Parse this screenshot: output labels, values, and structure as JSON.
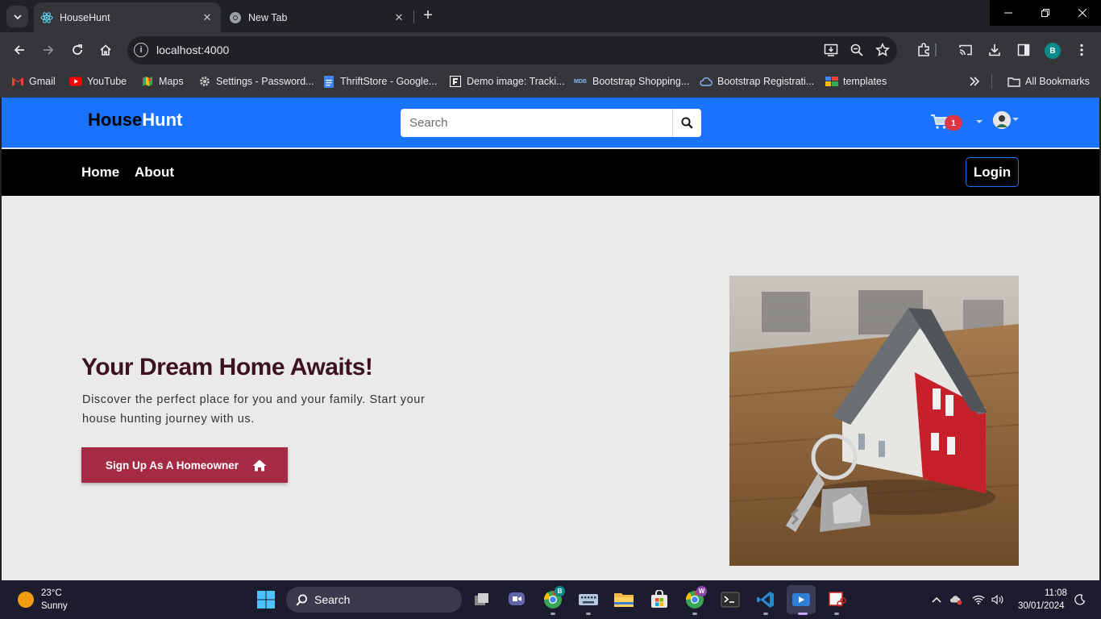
{
  "browser": {
    "tabs": [
      {
        "title": "HouseHunt",
        "active": true,
        "icon": "react-icon"
      },
      {
        "title": "New Tab",
        "active": false,
        "icon": "chrome-icon"
      }
    ],
    "url": "localhost:4000",
    "profile_initial": "B",
    "bookmarks": [
      {
        "label": "Gmail",
        "icon": "gmail-icon"
      },
      {
        "label": "YouTube",
        "icon": "youtube-icon"
      },
      {
        "label": "Maps",
        "icon": "maps-icon"
      },
      {
        "label": "Settings - Password...",
        "icon": "gear-icon"
      },
      {
        "label": "ThriftStore - Google...",
        "icon": "docs-icon"
      },
      {
        "label": "Demo image: Tracki...",
        "icon": "framer-icon"
      },
      {
        "label": "Bootstrap Shopping...",
        "icon": "mdb-icon"
      },
      {
        "label": "Bootstrap Registrati...",
        "icon": "cloud-icon"
      },
      {
        "label": "templates",
        "icon": "templates-icon"
      }
    ],
    "all_bookmarks": "All Bookmarks",
    "mdb_badge": "MDB"
  },
  "header": {
    "brand_part1": "House",
    "brand_part2": "Hunt",
    "search_placeholder": "Search",
    "cart_count": "1"
  },
  "nav": {
    "home": "Home",
    "about": "About",
    "login": "Login"
  },
  "hero": {
    "title": "Your Dream Home Awaits!",
    "text": "Discover the perfect place for you and your family. Start your house hunting journey with us.",
    "cta": "Sign Up As A Homeowner"
  },
  "taskbar": {
    "temperature": "23°C",
    "condition": "Sunny",
    "search": "Search",
    "time": "11:08",
    "date": "30/01/2024",
    "chrome_badge_1": "B",
    "chrome_badge_2": "W"
  },
  "colors": {
    "header_blue": "#1a73fd",
    "nav_black": "#000000",
    "cta_maroon": "#a52a44",
    "title_color": "#3c1220",
    "badge_red": "#dc3545"
  }
}
